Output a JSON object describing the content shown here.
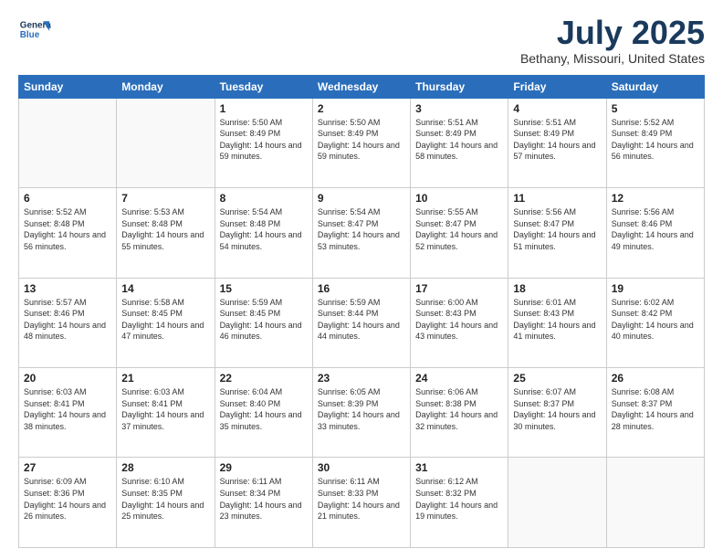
{
  "header": {
    "logo_line1": "General",
    "logo_line2": "Blue",
    "month_year": "July 2025",
    "location": "Bethany, Missouri, United States"
  },
  "days_of_week": [
    "Sunday",
    "Monday",
    "Tuesday",
    "Wednesday",
    "Thursday",
    "Friday",
    "Saturday"
  ],
  "weeks": [
    [
      {
        "day": "",
        "info": ""
      },
      {
        "day": "",
        "info": ""
      },
      {
        "day": "1",
        "sunrise": "5:50 AM",
        "sunset": "8:49 PM",
        "daylight": "14 hours and 59 minutes."
      },
      {
        "day": "2",
        "sunrise": "5:50 AM",
        "sunset": "8:49 PM",
        "daylight": "14 hours and 59 minutes."
      },
      {
        "day": "3",
        "sunrise": "5:51 AM",
        "sunset": "8:49 PM",
        "daylight": "14 hours and 58 minutes."
      },
      {
        "day": "4",
        "sunrise": "5:51 AM",
        "sunset": "8:49 PM",
        "daylight": "14 hours and 57 minutes."
      },
      {
        "day": "5",
        "sunrise": "5:52 AM",
        "sunset": "8:49 PM",
        "daylight": "14 hours and 56 minutes."
      }
    ],
    [
      {
        "day": "6",
        "sunrise": "5:52 AM",
        "sunset": "8:48 PM",
        "daylight": "14 hours and 56 minutes."
      },
      {
        "day": "7",
        "sunrise": "5:53 AM",
        "sunset": "8:48 PM",
        "daylight": "14 hours and 55 minutes."
      },
      {
        "day": "8",
        "sunrise": "5:54 AM",
        "sunset": "8:48 PM",
        "daylight": "14 hours and 54 minutes."
      },
      {
        "day": "9",
        "sunrise": "5:54 AM",
        "sunset": "8:47 PM",
        "daylight": "14 hours and 53 minutes."
      },
      {
        "day": "10",
        "sunrise": "5:55 AM",
        "sunset": "8:47 PM",
        "daylight": "14 hours and 52 minutes."
      },
      {
        "day": "11",
        "sunrise": "5:56 AM",
        "sunset": "8:47 PM",
        "daylight": "14 hours and 51 minutes."
      },
      {
        "day": "12",
        "sunrise": "5:56 AM",
        "sunset": "8:46 PM",
        "daylight": "14 hours and 49 minutes."
      }
    ],
    [
      {
        "day": "13",
        "sunrise": "5:57 AM",
        "sunset": "8:46 PM",
        "daylight": "14 hours and 48 minutes."
      },
      {
        "day": "14",
        "sunrise": "5:58 AM",
        "sunset": "8:45 PM",
        "daylight": "14 hours and 47 minutes."
      },
      {
        "day": "15",
        "sunrise": "5:59 AM",
        "sunset": "8:45 PM",
        "daylight": "14 hours and 46 minutes."
      },
      {
        "day": "16",
        "sunrise": "5:59 AM",
        "sunset": "8:44 PM",
        "daylight": "14 hours and 44 minutes."
      },
      {
        "day": "17",
        "sunrise": "6:00 AM",
        "sunset": "8:43 PM",
        "daylight": "14 hours and 43 minutes."
      },
      {
        "day": "18",
        "sunrise": "6:01 AM",
        "sunset": "8:43 PM",
        "daylight": "14 hours and 41 minutes."
      },
      {
        "day": "19",
        "sunrise": "6:02 AM",
        "sunset": "8:42 PM",
        "daylight": "14 hours and 40 minutes."
      }
    ],
    [
      {
        "day": "20",
        "sunrise": "6:03 AM",
        "sunset": "8:41 PM",
        "daylight": "14 hours and 38 minutes."
      },
      {
        "day": "21",
        "sunrise": "6:03 AM",
        "sunset": "8:41 PM",
        "daylight": "14 hours and 37 minutes."
      },
      {
        "day": "22",
        "sunrise": "6:04 AM",
        "sunset": "8:40 PM",
        "daylight": "14 hours and 35 minutes."
      },
      {
        "day": "23",
        "sunrise": "6:05 AM",
        "sunset": "8:39 PM",
        "daylight": "14 hours and 33 minutes."
      },
      {
        "day": "24",
        "sunrise": "6:06 AM",
        "sunset": "8:38 PM",
        "daylight": "14 hours and 32 minutes."
      },
      {
        "day": "25",
        "sunrise": "6:07 AM",
        "sunset": "8:37 PM",
        "daylight": "14 hours and 30 minutes."
      },
      {
        "day": "26",
        "sunrise": "6:08 AM",
        "sunset": "8:37 PM",
        "daylight": "14 hours and 28 minutes."
      }
    ],
    [
      {
        "day": "27",
        "sunrise": "6:09 AM",
        "sunset": "8:36 PM",
        "daylight": "14 hours and 26 minutes."
      },
      {
        "day": "28",
        "sunrise": "6:10 AM",
        "sunset": "8:35 PM",
        "daylight": "14 hours and 25 minutes."
      },
      {
        "day": "29",
        "sunrise": "6:11 AM",
        "sunset": "8:34 PM",
        "daylight": "14 hours and 23 minutes."
      },
      {
        "day": "30",
        "sunrise": "6:11 AM",
        "sunset": "8:33 PM",
        "daylight": "14 hours and 21 minutes."
      },
      {
        "day": "31",
        "sunrise": "6:12 AM",
        "sunset": "8:32 PM",
        "daylight": "14 hours and 19 minutes."
      },
      {
        "day": "",
        "info": ""
      },
      {
        "day": "",
        "info": ""
      }
    ]
  ]
}
